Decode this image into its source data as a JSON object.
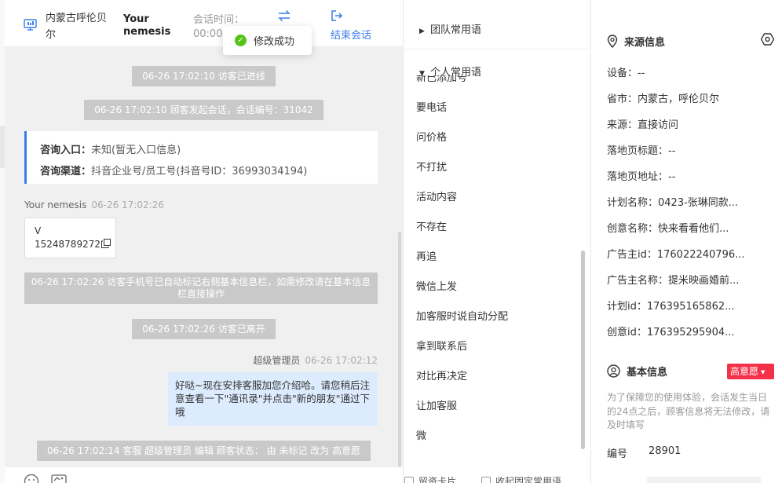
{
  "chat": {
    "header": {
      "location": "内蒙古呼伦贝尔",
      "visitor_name": "Your nemesis",
      "time_label": "会话时间：",
      "time_value": "00:00:",
      "transfer_icon": "swap-icon",
      "end_label": "结束会话",
      "end_icon": "exit-icon"
    },
    "toast": {
      "text": "修改成功",
      "icon": "check-circle-icon"
    },
    "messages": {
      "sys_enter": "06-26 17:02:10 访客已进线",
      "sys_start": "06-26 17:02:10 顾客发起会话，会话编号：31042",
      "entry_label": "咨询入口：",
      "entry_value": "未知(暂无入口信息)",
      "channel_label": "咨询渠道：",
      "channel_value": "抖音企业号/员工号(抖音号ID：36993034194)",
      "visitor_sender": "Your nemesis",
      "visitor_time": "06-26 17:02:26",
      "visitor_line1": "V",
      "visitor_line2": "15248789272",
      "sys_phone": "06-26 17:02:26 访客手机号已自动标记右侧基本信息栏，如需修改请在基本信息栏直接操作",
      "sys_leave": "06-26 17:02:26 访客已离开",
      "agent_sender": "超级管理员",
      "agent_time": "06-26 17:02:12",
      "agent_text": "好哒~现在安排客服加您介绍哈。请您稍后注意查看一下\"通讯录\"并点击\"新的朋友\"通过下哦",
      "sys_status": "06-26 17:02:14 客服 超级管理员 编辑 顾客状态： 由 未标记 改为 高意愿"
    }
  },
  "phrases": {
    "team_label": "团队常用语",
    "personal_label": "个人常用语",
    "clipped_item": "新已添加号",
    "items": [
      "要电话",
      "问价格",
      "不打扰",
      "活动内容",
      "不存在",
      "再追",
      "微信上发",
      "加客服时说自动分配",
      "拿到联系后",
      "对比再决定",
      "让加客服",
      "微"
    ],
    "footer_left": "留资卡片",
    "footer_right": "收起固定常用语"
  },
  "info": {
    "source_title": "来源信息",
    "source_rows": [
      "设备：--",
      "省市：内蒙古，呼伦贝尔",
      "来源：直接访问",
      "落地页标题：--",
      "落地页地址：--",
      "计划名称：0423-张琳同款...",
      "创意名称：快来看看他们...",
      "广告主id：176022240796...",
      "广告主名称：提米映画婚前...",
      "计划id：176395165862...",
      "创意id：176395295904..."
    ],
    "basic_title": "基本信息",
    "intent_badge": "高意愿",
    "note": "为了保障您的使用体验，会话发生当日的24点之后，顾客信息将无法修改，请及时填写",
    "number_label": "编号",
    "number_value": "28901",
    "accent": "#3a7ee8",
    "badge_color": "#f5314a"
  }
}
